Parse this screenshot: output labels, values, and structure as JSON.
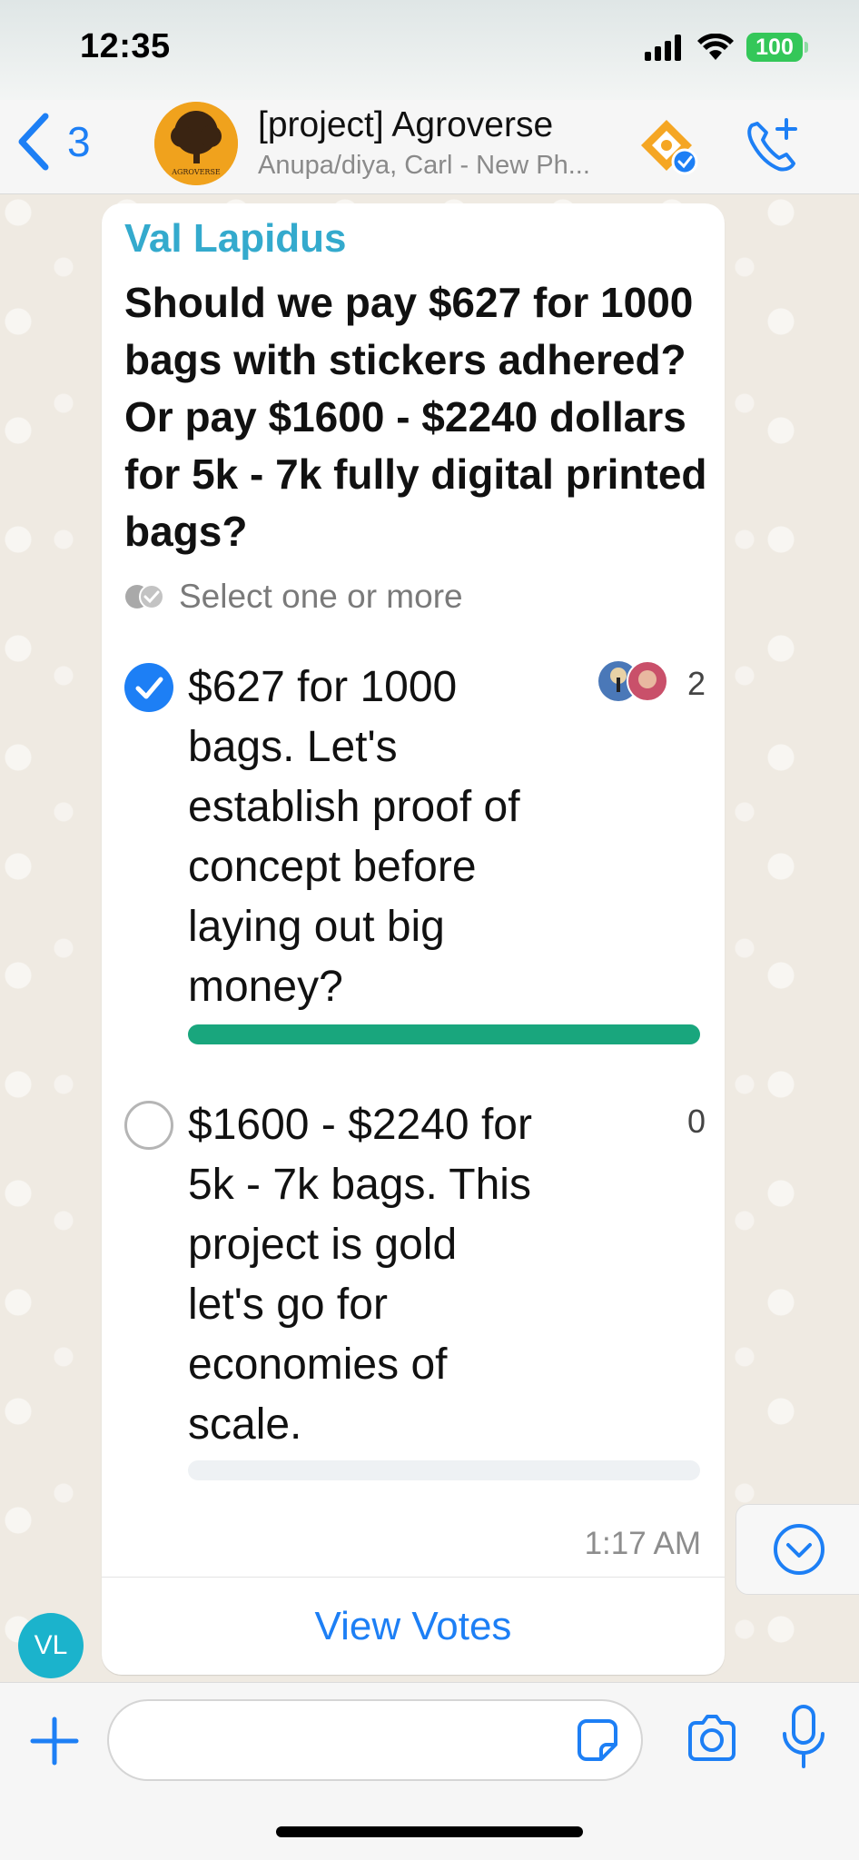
{
  "status_bar": {
    "time": "12:35",
    "battery": "100",
    "icons": [
      "signal-icon",
      "wifi-icon",
      "battery-icon"
    ]
  },
  "header": {
    "back_count": "3",
    "title": "[project] Agroverse",
    "subtitle": "Anupa/diya, Carl - New Ph...",
    "avatar_logo_text": "AGROVERSE"
  },
  "poll": {
    "sender": "Val Lapidus",
    "question": "Should we pay $627 for 1000 bags with stickers adhered?  Or pay $1600 - $2240 dollars for  5k - 7k fully digital printed bags?",
    "hint": "Select one or more",
    "options": [
      {
        "text": "$627 for 1000 bags.  Let's establish proof of concept before laying out big money?",
        "count": "2",
        "selected": true,
        "fill_fraction": 1.0
      },
      {
        "text": "$1600 - $2240 for 5k - 7k bags.  This project is gold let's go for economies of scale.",
        "count": "0",
        "selected": false,
        "fill_fraction": 0.0
      }
    ],
    "time": "1:17 AM",
    "view_votes_label": "View Votes"
  },
  "avatar": {
    "initials": "VL"
  },
  "composer": {
    "placeholder": ""
  },
  "colors": {
    "accent": "#1d7ff5",
    "sender": "#34aacd",
    "vote_bar": "#19a67d",
    "chat_bg": "#efeae2"
  }
}
